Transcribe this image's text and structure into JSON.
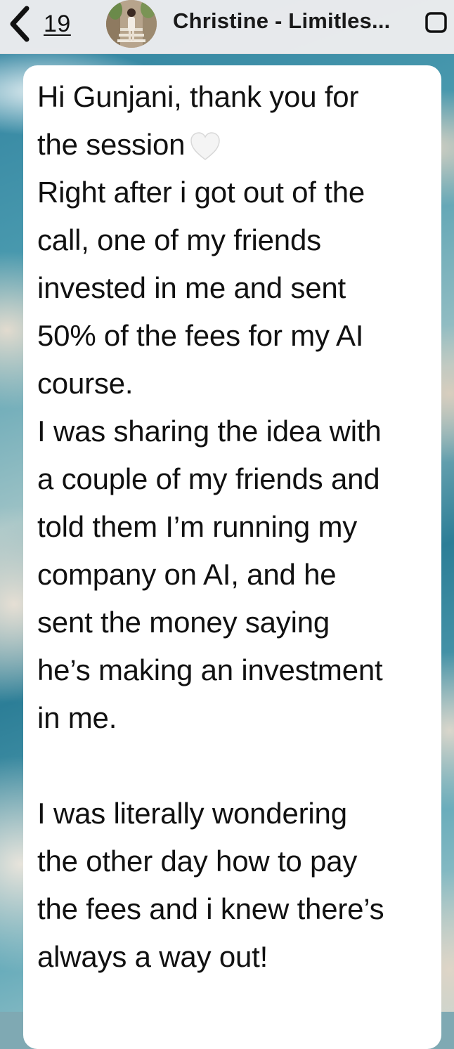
{
  "header": {
    "back_count": "19",
    "title": "Christine - Limitles...",
    "back_icon": "chevron-left-icon",
    "avatar_icon": "avatar",
    "action_icon": "square-icon"
  },
  "message": {
    "line1": "Hi Gunjani, thank you for",
    "line2_text": "the session",
    "heart_icon": "white-heart-icon",
    "heart_glyph": "🤍",
    "body": "Right after i got out of the\ncall, one of my friends\ninvested in me and sent\n50% of the fees for my AI\ncourse.\nI was sharing the idea with\na couple of my friends and\ntold them I’m running my\ncompany on AI, and he\nsent the money saying\nhe’s making an investment\nin me.\n\nI was literally wondering\nthe other day how to pay\nthe fees and i knew there’s\nalways a way out!"
  },
  "colors": {
    "header_bg": "#ECECEE",
    "bubble_bg": "#FFFFFF",
    "text": "#111111"
  }
}
